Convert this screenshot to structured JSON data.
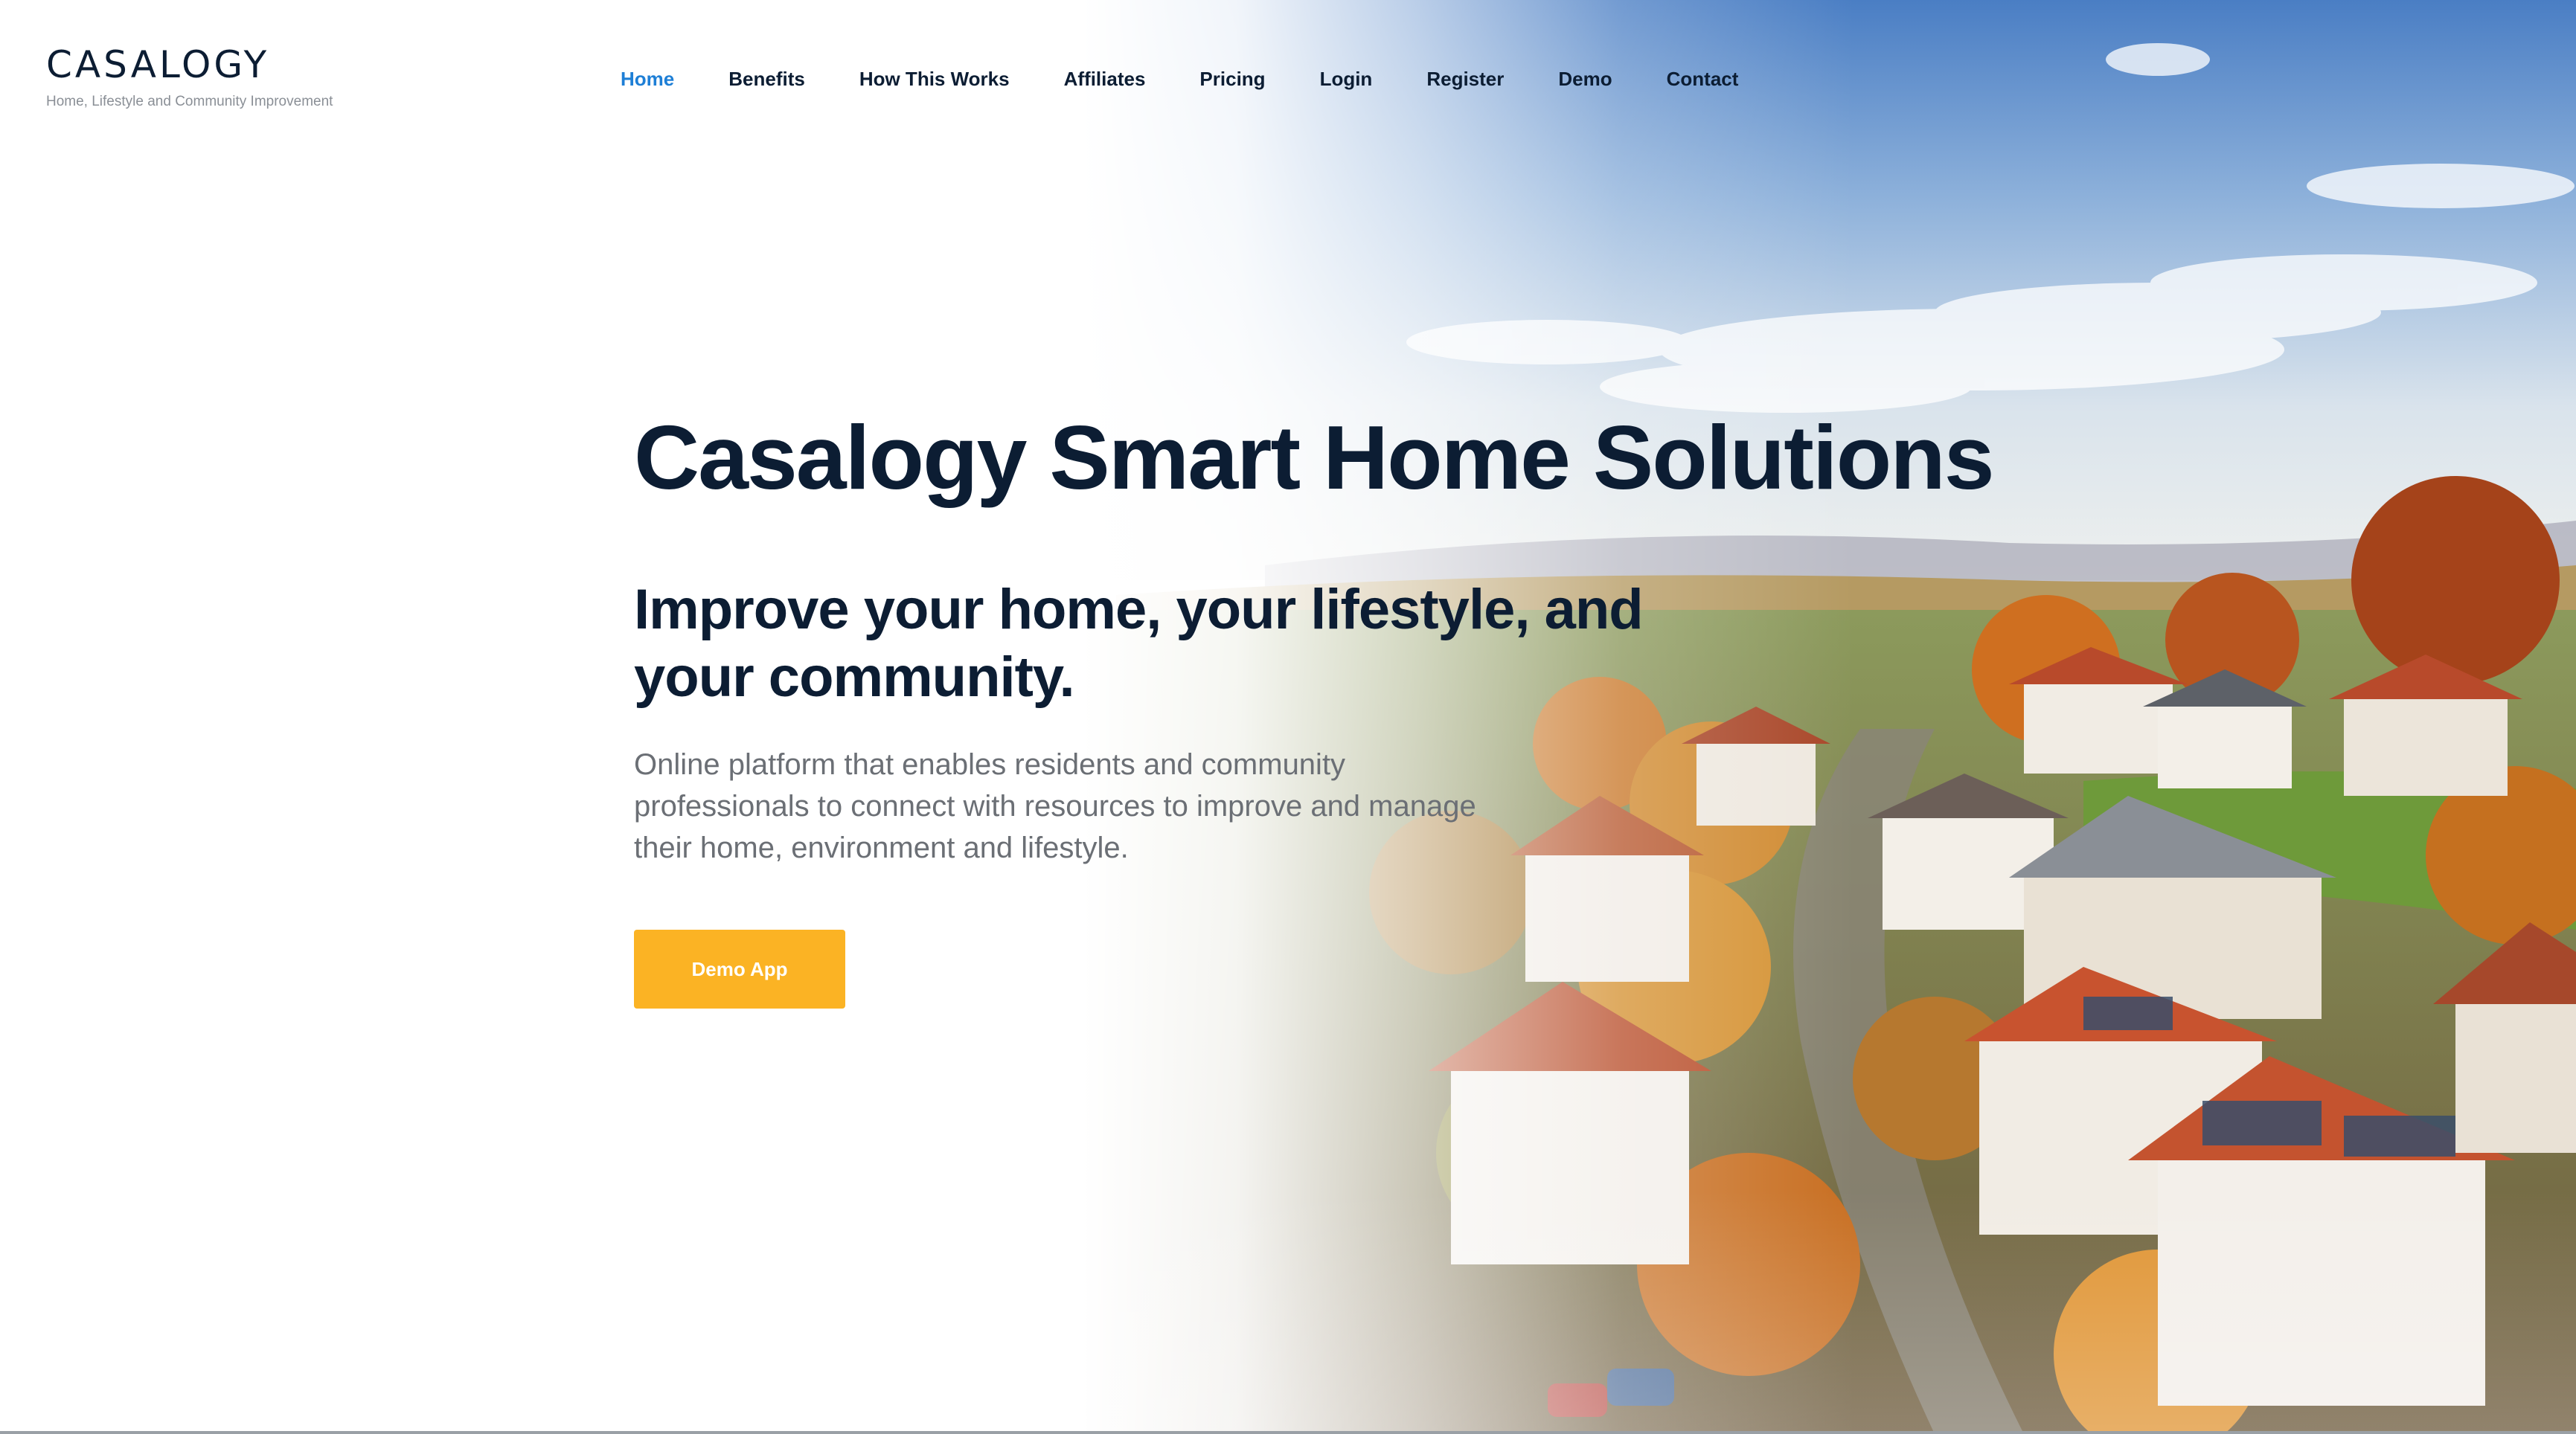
{
  "brand": {
    "name": "CASALOGY",
    "tagline": "Home, Lifestyle and Community Improvement"
  },
  "nav": {
    "items": [
      {
        "label": "Home",
        "active": true
      },
      {
        "label": "Benefits"
      },
      {
        "label": "How This Works"
      },
      {
        "label": "Affiliates"
      },
      {
        "label": "Pricing"
      },
      {
        "label": "Login"
      },
      {
        "label": "Register"
      },
      {
        "label": "Demo"
      },
      {
        "label": "Contact"
      }
    ]
  },
  "hero": {
    "title": "Casalogy Smart Home Solutions",
    "subtitle": "Improve your home, your lifestyle, and your community.",
    "description": "Online platform that enables residents and community professionals to connect with resources to improve and manage their home, environment and lifestyle.",
    "cta_label": "Demo App",
    "background": "aerial-village-photo"
  },
  "colors": {
    "navy": "#0c1d33",
    "nav_active": "#1e7fd6",
    "cta": "#fbb324",
    "body_text": "#6b6f75"
  }
}
